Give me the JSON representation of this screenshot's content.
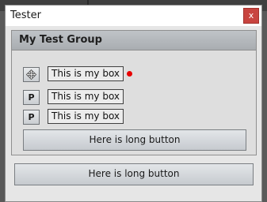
{
  "window": {
    "title": "Tester",
    "close_label": "x"
  },
  "group": {
    "title": "My Test Group",
    "rows": [
      {
        "button_icon": "move-icon",
        "button_label": "",
        "box_text": "This is my box",
        "status_dot": true
      },
      {
        "button_icon": "",
        "button_label": "P",
        "box_text": "This is my box",
        "status_dot": false
      },
      {
        "button_icon": "",
        "button_label": "P",
        "box_text": "This is my box",
        "status_dot": false
      }
    ],
    "long_button_label": "Here is long button"
  },
  "footer": {
    "long_button_label": "Here is long button"
  },
  "colors": {
    "close_button": "#c8443f",
    "status_dot": "#e80000",
    "group_header": "#b4b8bc"
  }
}
